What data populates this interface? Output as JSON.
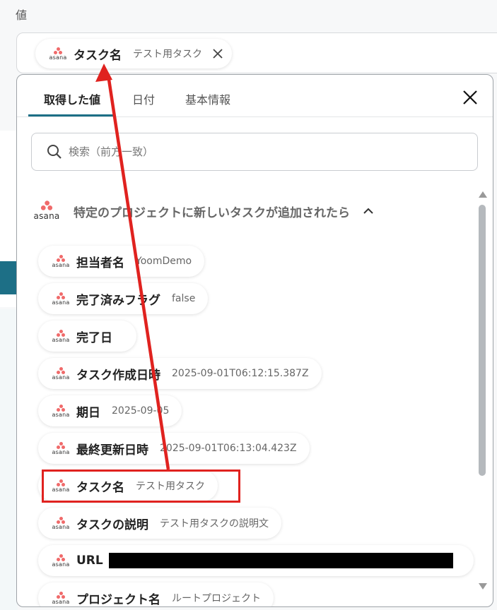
{
  "field": {
    "label": "値"
  },
  "selected_value": {
    "name": "タスク名",
    "value": "テスト用タスク",
    "logo_text": "asana"
  },
  "tabs": [
    "取得した値",
    "日付",
    "基本情報"
  ],
  "search": {
    "placeholder": "検索（前方一致）"
  },
  "group": {
    "title": "特定のプロジェクトに新しいタスクが追加されたら",
    "logo_text": "asana"
  },
  "items": [
    {
      "name": "担当者名",
      "value": "YoomDemo"
    },
    {
      "name": "完了済みフラグ",
      "value": "false"
    },
    {
      "name": "完了日",
      "value": ""
    },
    {
      "name": "タスク作成日時",
      "value": "2025-09-01T06:12:15.387Z"
    },
    {
      "name": "期日",
      "value": "2025-09-05"
    },
    {
      "name": "最終更新日時",
      "value": "2025-09-01T06:13:04.423Z"
    },
    {
      "name": "タスク名",
      "value": "テスト用タスク"
    },
    {
      "name": "タスクの説明",
      "value": "テスト用タスクの説明文"
    },
    {
      "name": "URL",
      "value": ""
    },
    {
      "name": "プロジェクト名",
      "value": "ルートプロジェクト"
    }
  ],
  "logo_text": "asana",
  "colors": {
    "accent": "#1d6f86",
    "annotation_red": "#e0221f",
    "asana": "#f06a6a"
  }
}
